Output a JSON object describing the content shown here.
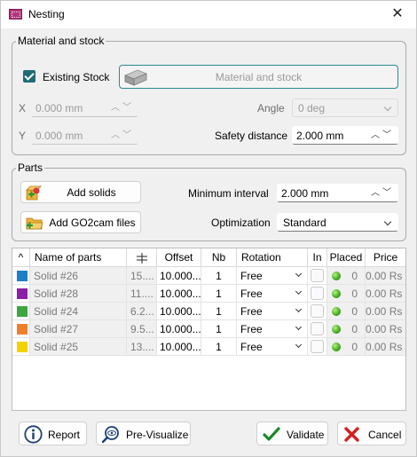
{
  "window": {
    "title": "Nesting",
    "close_glyph": "✕"
  },
  "material_group": {
    "legend": "Material and stock",
    "existing_stock_label": "Existing Stock",
    "existing_stock_checked": true,
    "material_button_label": "Material and stock",
    "x_label": "X",
    "x_value": "0.000 mm",
    "y_label": "Y",
    "y_value": "0.000 mm",
    "angle_label": "Angle",
    "angle_value": "0 deg",
    "safety_label": "Safety distance",
    "safety_value": "2.000 mm"
  },
  "parts_group": {
    "legend": "Parts",
    "add_solids_label": "Add solids",
    "add_go2cam_label": "Add GO2cam files",
    "min_interval_label": "Minimum interval",
    "min_interval_value": "2.000 mm",
    "optimization_label": "Optimization",
    "optimization_value": "Standard"
  },
  "table": {
    "headers": {
      "sort": "^",
      "name": "Name of parts",
      "offset": "Offset",
      "nb": "Nb",
      "rotation": "Rotation",
      "in": "In",
      "placed": "Placed",
      "price": "Price"
    },
    "rows": [
      {
        "color": "#1e7ec8",
        "name": "Solid #26",
        "size": "15....",
        "offset": "10.000...",
        "nb": "1",
        "rotation": "Free",
        "placed": "0",
        "price": "0.00 Rs"
      },
      {
        "color": "#8b1fa8",
        "name": "Solid #28",
        "size": "11....",
        "offset": "10.000...",
        "nb": "1",
        "rotation": "Free",
        "placed": "0",
        "price": "0.00 Rs"
      },
      {
        "color": "#3fa63f",
        "name": "Solid #24",
        "size": "6.2...",
        "offset": "10.000...",
        "nb": "1",
        "rotation": "Free",
        "placed": "0",
        "price": "0.00 Rs"
      },
      {
        "color": "#f07f2c",
        "name": "Solid #27",
        "size": "9.5...",
        "offset": "10.000...",
        "nb": "1",
        "rotation": "Free",
        "placed": "0",
        "price": "0.00 Rs"
      },
      {
        "color": "#f2d200",
        "name": "Solid #25",
        "size": "13....",
        "offset": "10.000...",
        "nb": "1",
        "rotation": "Free",
        "placed": "0",
        "price": "0.00 Rs"
      }
    ]
  },
  "footer": {
    "report_label": "Report",
    "previsualize_label": "Pre-Visualize",
    "validate_label": "Validate",
    "cancel_label": "Cancel"
  },
  "colors": {
    "accent": "#1f6b77",
    "focus_border": "#2a8a96",
    "validate_check": "#1a8a2a",
    "cancel_x": "#d42020"
  }
}
